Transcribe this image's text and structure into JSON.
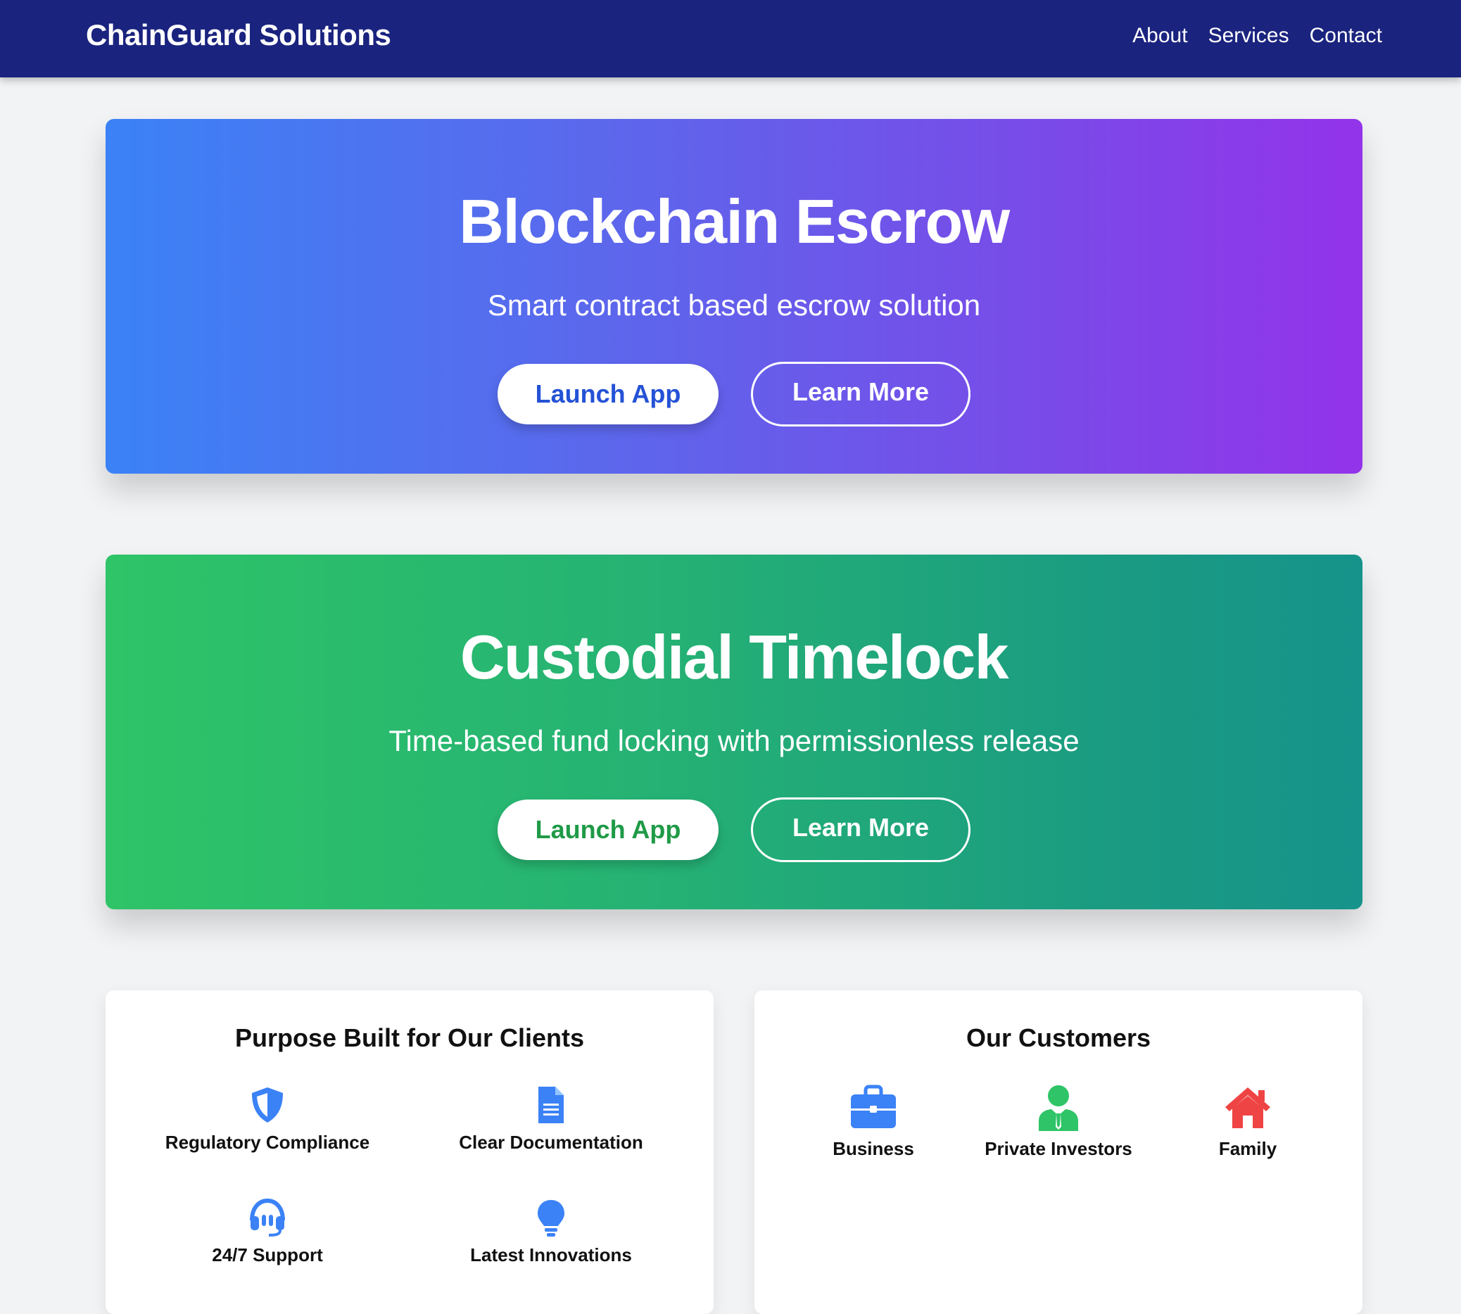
{
  "header": {
    "brand": "ChainGuard Solutions",
    "nav": [
      "About",
      "Services",
      "Contact"
    ]
  },
  "heroes": [
    {
      "title": "Blockchain Escrow",
      "subtitle": "Smart contract based escrow solution",
      "primary_label": "Launch App",
      "secondary_label": "Learn More"
    },
    {
      "title": "Custodial Timelock",
      "subtitle": "Time-based fund locking with permissionless release",
      "primary_label": "Launch App",
      "secondary_label": "Learn More"
    }
  ],
  "clients_card": {
    "title": "Purpose Built for Our Clients",
    "items": [
      {
        "label": "Regulatory Compliance",
        "icon": "shield-icon"
      },
      {
        "label": "Clear Documentation",
        "icon": "document-icon"
      },
      {
        "label": "24/7 Support",
        "icon": "headset-icon"
      },
      {
        "label": "Latest Innovations",
        "icon": "lightbulb-icon"
      }
    ]
  },
  "customers_card": {
    "title": "Our Customers",
    "items": [
      {
        "label": "Business",
        "icon": "briefcase-icon"
      },
      {
        "label": "Private Investors",
        "icon": "investor-icon"
      },
      {
        "label": "Family",
        "icon": "house-icon"
      }
    ]
  },
  "colors": {
    "nav_bg": "#1a237e",
    "blue_icon": "#3b82f6",
    "green_icon": "#2ec467",
    "red_icon": "#ef4444"
  }
}
